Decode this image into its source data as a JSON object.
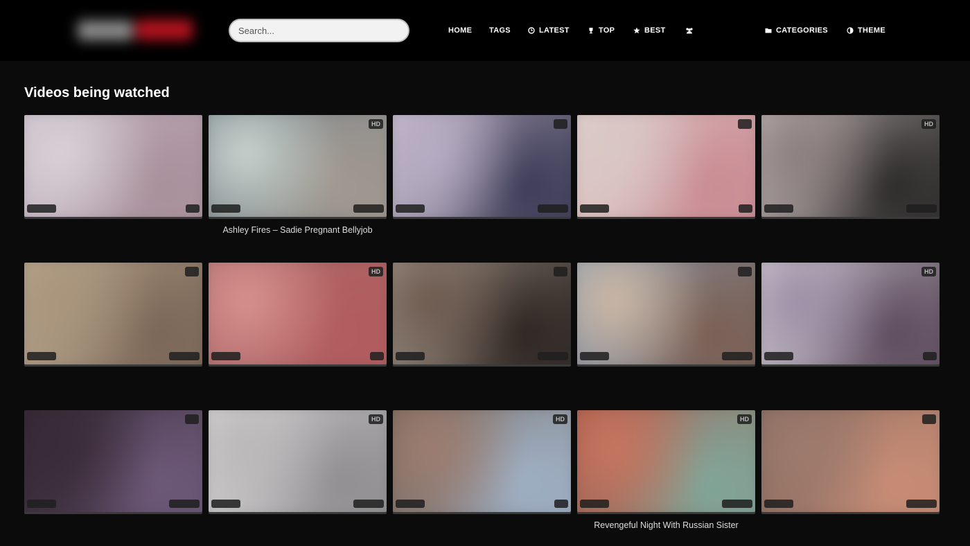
{
  "header": {
    "search_placeholder": "Search...",
    "nav": [
      {
        "label": "HOME",
        "icon": ""
      },
      {
        "label": "TAGS",
        "icon": ""
      },
      {
        "label": "LATEST",
        "icon": "clock-icon"
      },
      {
        "label": "TOP",
        "icon": "trophy-icon"
      },
      {
        "label": "BEST",
        "icon": "star-icon"
      },
      {
        "label": "",
        "icon": "users-icon"
      },
      {
        "label": "CATEGORIES",
        "icon": "folder-icon"
      },
      {
        "label": "THEME",
        "icon": "contrast-icon"
      }
    ]
  },
  "section_title": "Videos being watched",
  "videos": [
    {
      "title": "",
      "hd": "",
      "colors": [
        "#d8d2d6",
        "#a8909a",
        "#cbbccc"
      ]
    },
    {
      "title": "Ashley Fires – Sadie Pregnant Bellyjob",
      "hd": "HD",
      "colors": [
        "#c9d4cf",
        "#a19890",
        "#6f7f88"
      ]
    },
    {
      "title": "",
      "hd": "",
      "colors": [
        "#b7adc4",
        "#3b3a55",
        "#d6c8d8"
      ]
    },
    {
      "title": "",
      "hd": "",
      "colors": [
        "#d9c8c6",
        "#c98a92",
        "#e2d6d0"
      ]
    },
    {
      "title": "",
      "hd": "HD",
      "colors": [
        "#8c7e7e",
        "#2a2828",
        "#d8cdcc"
      ]
    },
    {
      "title": "",
      "hd": "",
      "colors": [
        "#a8957c",
        "#7a6657",
        "#c2ae94"
      ]
    },
    {
      "title": "",
      "hd": "HD",
      "colors": [
        "#d8928f",
        "#b25c5e",
        "#a86b6c"
      ]
    },
    {
      "title": "",
      "hd": "",
      "colors": [
        "#6d5a4f",
        "#2d2522",
        "#b8ab9d"
      ]
    },
    {
      "title": "",
      "hd": "",
      "colors": [
        "#cdb8a4",
        "#7a5f53",
        "#8aa2bd"
      ]
    },
    {
      "title": "",
      "hd": "HD",
      "colors": [
        "#9d8ea6",
        "#5c4a5d",
        "#e8e6ea"
      ]
    },
    {
      "title": "",
      "hd": "",
      "colors": [
        "#3a2b38",
        "#6e5a7a",
        "#2a1f28"
      ]
    },
    {
      "title": "",
      "hd": "HD",
      "colors": [
        "#b9b7b8",
        "#8f8d90",
        "#e3e2e2"
      ]
    },
    {
      "title": "",
      "hd": "HD",
      "colors": [
        "#9e7d70",
        "#9fb1c6",
        "#6e5a4a"
      ]
    },
    {
      "title": "Revengeful Night With Russian Sister",
      "hd": "HD",
      "colors": [
        "#c8765f",
        "#7fa79a",
        "#a84d3f"
      ]
    },
    {
      "title": "",
      "hd": "",
      "colors": [
        "#9d7b6e",
        "#c98d76",
        "#7a6359"
      ]
    }
  ]
}
